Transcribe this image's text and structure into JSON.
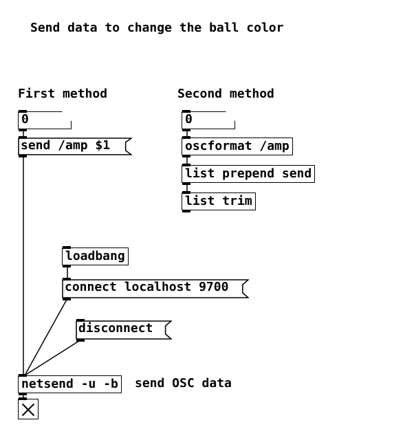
{
  "title": "Send data to change the ball color",
  "method1": {
    "label": "First method",
    "number_value": "0",
    "message": "send /amp $1"
  },
  "method2": {
    "label": "Second method",
    "number_value": "0",
    "oscformat": "oscformat /amp",
    "prepend": "list prepend send",
    "trim": "list trim"
  },
  "net": {
    "loadbang": "loadbang",
    "connect_msg": "connect localhost 9700",
    "disconnect_msg": "disconnect",
    "netsend": "netsend -u -b",
    "comment": "send OSC data"
  }
}
